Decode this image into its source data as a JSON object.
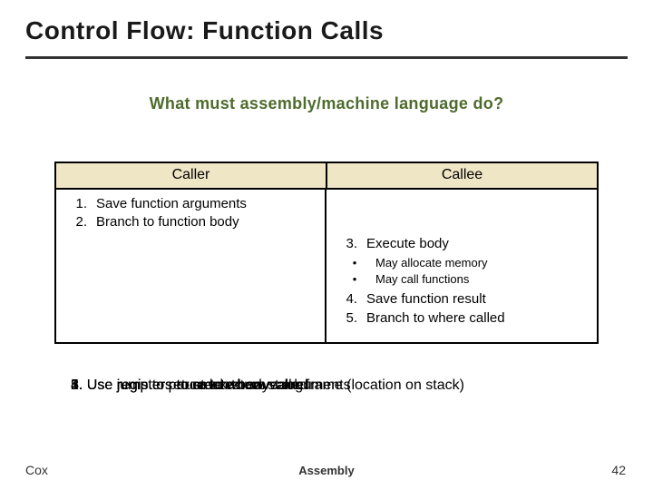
{
  "title": "Control Flow: Function Calls",
  "subtitle": "What must assembly/machine language do?",
  "table": {
    "headers": {
      "left": "Caller",
      "right": "Callee"
    },
    "caller_rows": [
      {
        "num": "1.",
        "text": "Save function arguments"
      },
      {
        "num": "2.",
        "text": "Branch to function body"
      }
    ],
    "callee_rows_top": [
      {
        "num": "3.",
        "text": "Execute body"
      }
    ],
    "callee_sub": [
      {
        "bullet": "•",
        "text": "May allocate memory"
      },
      {
        "bullet": "•",
        "text": "May call functions"
      }
    ],
    "callee_rows_bottom": [
      {
        "num": "4.",
        "text": "Save function result"
      },
      {
        "num": "5.",
        "text": "Branch to where called"
      }
    ]
  },
  "overlap_lines": [
    "1. Use registers or stack to save arguments",
    "2. Use jump to procedure body",
    "5. Use jump to return to where called",
    "4. Use registers to save return value",
    "3. Use registers to create new stack frame (location on stack)"
  ],
  "footer": {
    "left": "Cox",
    "center": "Assembly",
    "right": "42"
  }
}
